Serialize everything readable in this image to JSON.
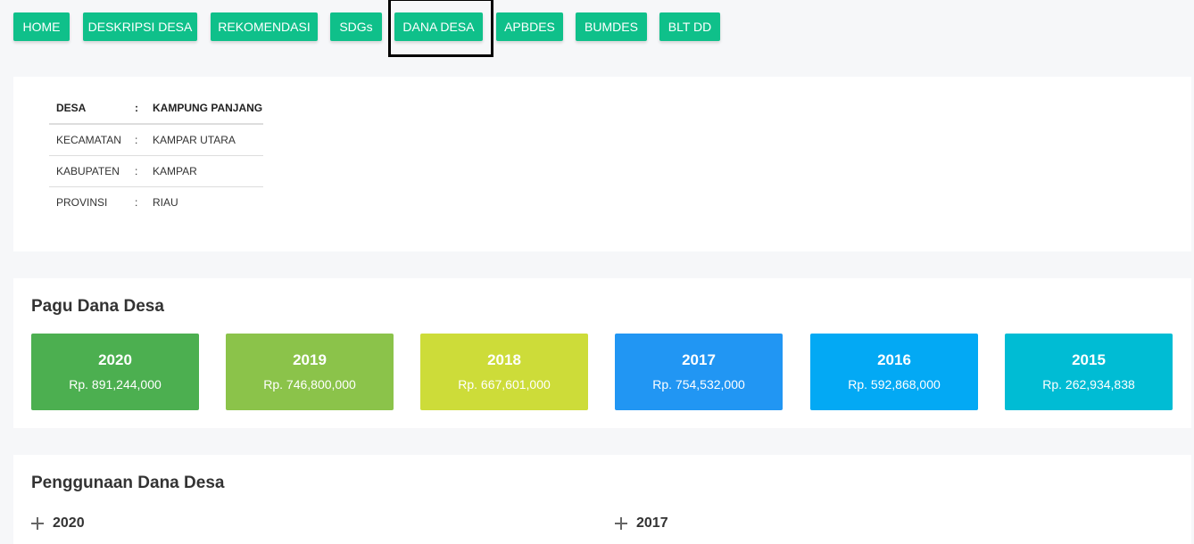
{
  "nav": {
    "items": [
      {
        "label": "HOME"
      },
      {
        "label": "DESKRIPSI DESA"
      },
      {
        "label": "REKOMENDASI"
      },
      {
        "label": "SDGs"
      },
      {
        "label": "DANA DESA"
      },
      {
        "label": "APBDES"
      },
      {
        "label": "BUMDES"
      },
      {
        "label": "BLT DD"
      }
    ],
    "button_color": "#0fc08a",
    "active": "DANA DESA"
  },
  "info": {
    "rows": [
      {
        "label": "DESA",
        "sep": ":",
        "value": "KAMPUNG PANJANG"
      },
      {
        "label": "KECAMATAN",
        "sep": ":",
        "value": "KAMPAR UTARA"
      },
      {
        "label": "KABUPATEN",
        "sep": ":",
        "value": "KAMPAR"
      },
      {
        "label": "PROVINSI",
        "sep": ":",
        "value": "RIAU"
      }
    ]
  },
  "pagu": {
    "title": "Pagu Dana Desa",
    "boxes": [
      {
        "year": "2020",
        "amount": "Rp. 891,244,000",
        "color": "#4caf50"
      },
      {
        "year": "2019",
        "amount": "Rp. 746,800,000",
        "color": "#8bc34a"
      },
      {
        "year": "2018",
        "amount": "Rp. 667,601,000",
        "color": "#cddc39"
      },
      {
        "year": "2017",
        "amount": "Rp. 754,532,000",
        "color": "#2196f3"
      },
      {
        "year": "2016",
        "amount": "Rp. 592,868,000",
        "color": "#03a9f4"
      },
      {
        "year": "2015",
        "amount": "Rp. 262,934,838",
        "color": "#00bcd4"
      }
    ]
  },
  "penggunaan": {
    "title": "Penggunaan Dana Desa",
    "items": [
      {
        "label": "2020",
        "icon": "plus-icon"
      },
      {
        "label": "2017",
        "icon": "plus-icon"
      }
    ]
  }
}
